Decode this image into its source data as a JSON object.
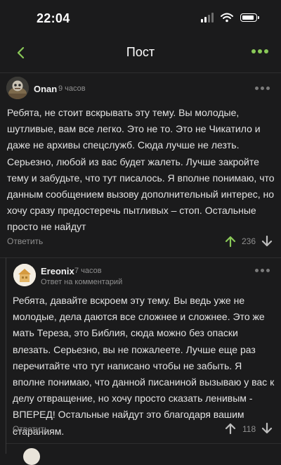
{
  "status": {
    "time": "22:04"
  },
  "nav": {
    "title": "Пост"
  },
  "comments": [
    {
      "author": "Onan",
      "time": "9 часов",
      "text": "Ребята, не стоит вскрывать эту тему. Вы молодые, шутливые, вам все легко. Это не то. Это не Чикатило и даже не архивы спецслужб. Сюда лучше не лезть. Серьезно, любой из вас будет жалеть. Лучше закройте тему и забудьте, что тут писалось. Я вполне понимаю, что данным сообщением вызову дополнительный интерес, но хочу сразу предостеречь пытливых – стоп. Остальные просто не найдут",
      "reply_label": "Ответить",
      "score": "236"
    },
    {
      "author": "Ereonix",
      "time": "7 часов",
      "reply_hint": "Ответ на комментарий",
      "text": "Ребята, давайте вскроем эту тему. Вы ведь уже не молодые, дела даются все сложнее и сложнее. Это же мать Тереза, это Библия, сюда можно без опаски влезать. Серьезно, вы не пожалеете. Лучше еще раз перечитайте что тут написано чтобы не забыть. Я вполне понимаю, что данной писаниной вызываю у вас к делу отвращение, но хочу просто сказать ленивым - ВПЕРЕД! Остальные найдут это благодаря вашим стараниям.",
      "reply_label": "Ответить",
      "score": "118"
    }
  ],
  "colors": {
    "accent": "#8ac858",
    "background": "#1b1b1c",
    "muted": "#8f8f8f"
  },
  "icons": [
    "signal-icon",
    "wifi-icon",
    "battery-icon",
    "back-chevron-icon",
    "more-icon",
    "upvote-arrow-icon",
    "downvote-arrow-icon"
  ]
}
